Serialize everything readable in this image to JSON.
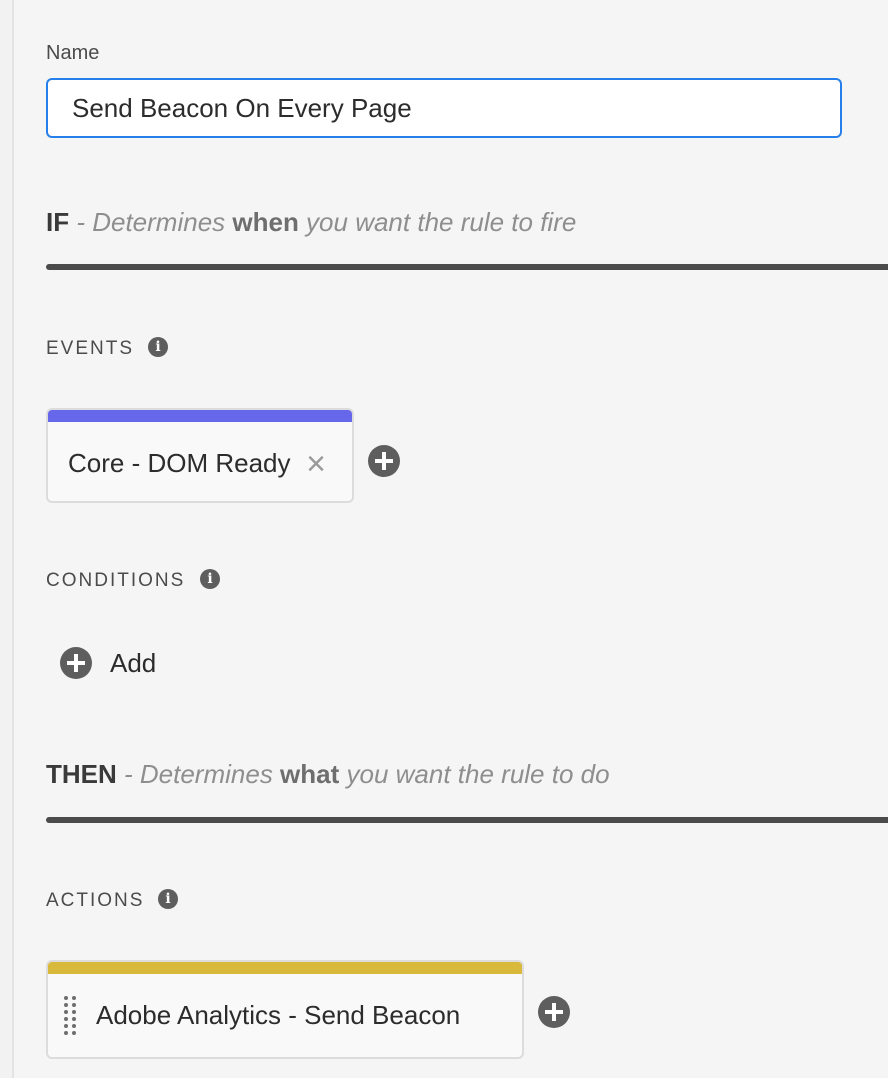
{
  "name_field": {
    "label": "Name",
    "value": "Send Beacon On Every Page"
  },
  "if_section": {
    "keyword": "IF",
    "dash": " - ",
    "desc_pre": "Determines ",
    "desc_bold": "when",
    "desc_post": " you want the rule to fire"
  },
  "events": {
    "label": "EVENTS",
    "info_icon": "info-icon",
    "items": [
      {
        "label": "Core - DOM Ready",
        "accent_color": "#6767ec"
      }
    ]
  },
  "conditions": {
    "label": "CONDITIONS",
    "info_icon": "info-icon",
    "add_label": "Add"
  },
  "then_section": {
    "keyword": "THEN",
    "dash": " - ",
    "desc_pre": "Determines ",
    "desc_bold": "what",
    "desc_post": " you want the rule to do"
  },
  "actions": {
    "label": "ACTIONS",
    "info_icon": "info-icon",
    "items": [
      {
        "label": "Adobe Analytics - Send Beacon",
        "accent_color": "#d9b93b"
      }
    ]
  },
  "colors": {
    "focus_blue": "#2680eb",
    "rule_dark": "#4b4b4b",
    "icon_gray": "#5e5e5e"
  }
}
